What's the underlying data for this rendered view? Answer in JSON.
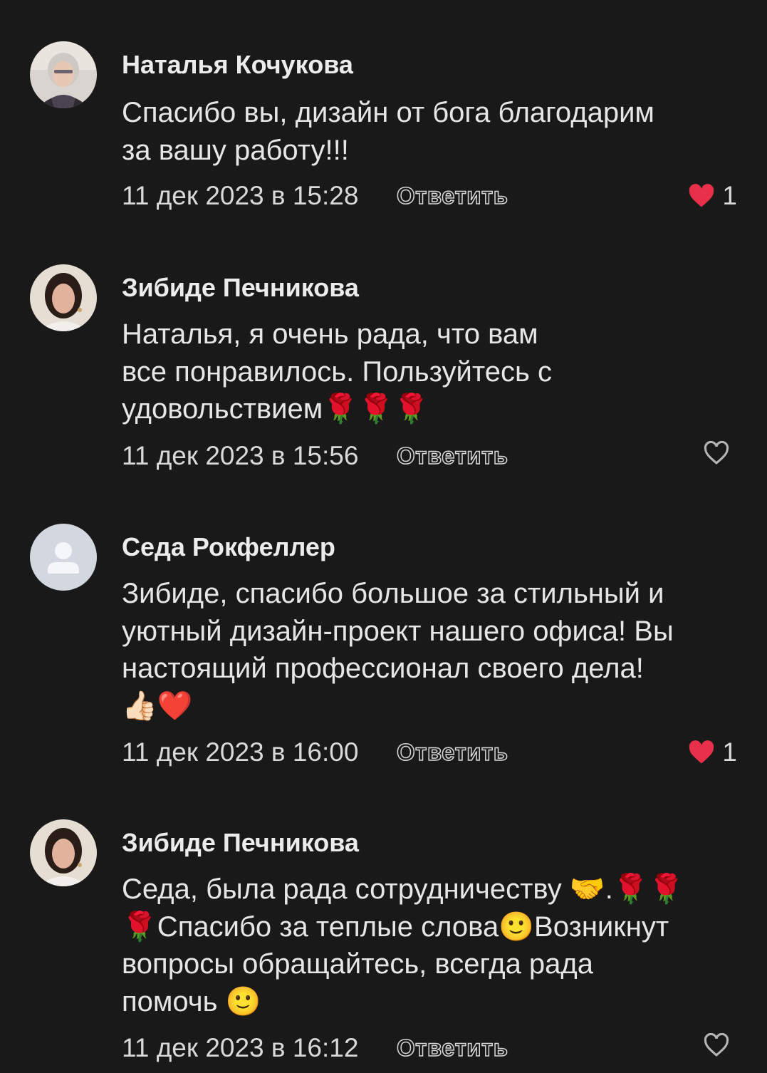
{
  "comments": [
    {
      "author": "Наталья Кочукова",
      "text": "Спасибо вы, дизайн от бога благодарим\nза вашу работу!!!",
      "date": "11 дек 2023 в 15:28",
      "reply_label": "Ответить",
      "liked": true,
      "likes": "1",
      "avatar": "photo-avatar-icon"
    },
    {
      "author": "Зибиде Печникова",
      "text": "Наталья, я очень рада, что вам\nвсе понравилось. Пользуйтесь с\nудовольствием🌹🌹🌹",
      "date": "11 дек 2023 в 15:56",
      "reply_label": "Ответить",
      "liked": false,
      "likes": "",
      "avatar": "photo-avatar-icon"
    },
    {
      "author": "Седа Рокфеллер",
      "text": "Зибиде, спасибо большое за стильный и\nуютный дизайн-проект нашего офиса! Вы\nнастоящий профессионал своего дела!\n👍🏻❤️",
      "date": "11 дек 2023 в 16:00",
      "reply_label": "Ответить",
      "liked": true,
      "likes": "1",
      "avatar": "default-user-icon"
    },
    {
      "author": "Зибиде Печникова",
      "text": "Седа, была рада сотрудничеству 🤝.🌹🌹\n🌹Спасибо за теплые слова🙂Возникнут\nвопросы обращайтесь, всегда рада\nпомочь 🙂",
      "date": "11 дек 2023 в 16:12",
      "reply_label": "Ответить",
      "liked": false,
      "likes": "",
      "avatar": "photo-avatar-icon"
    }
  ],
  "colors": {
    "background": "#191919",
    "like_active": "#e8304a",
    "like_inactive": "#b5b5b5",
    "default_avatar_bg": "#d3d8e0",
    "default_avatar_fg": "#f4f6f9"
  }
}
